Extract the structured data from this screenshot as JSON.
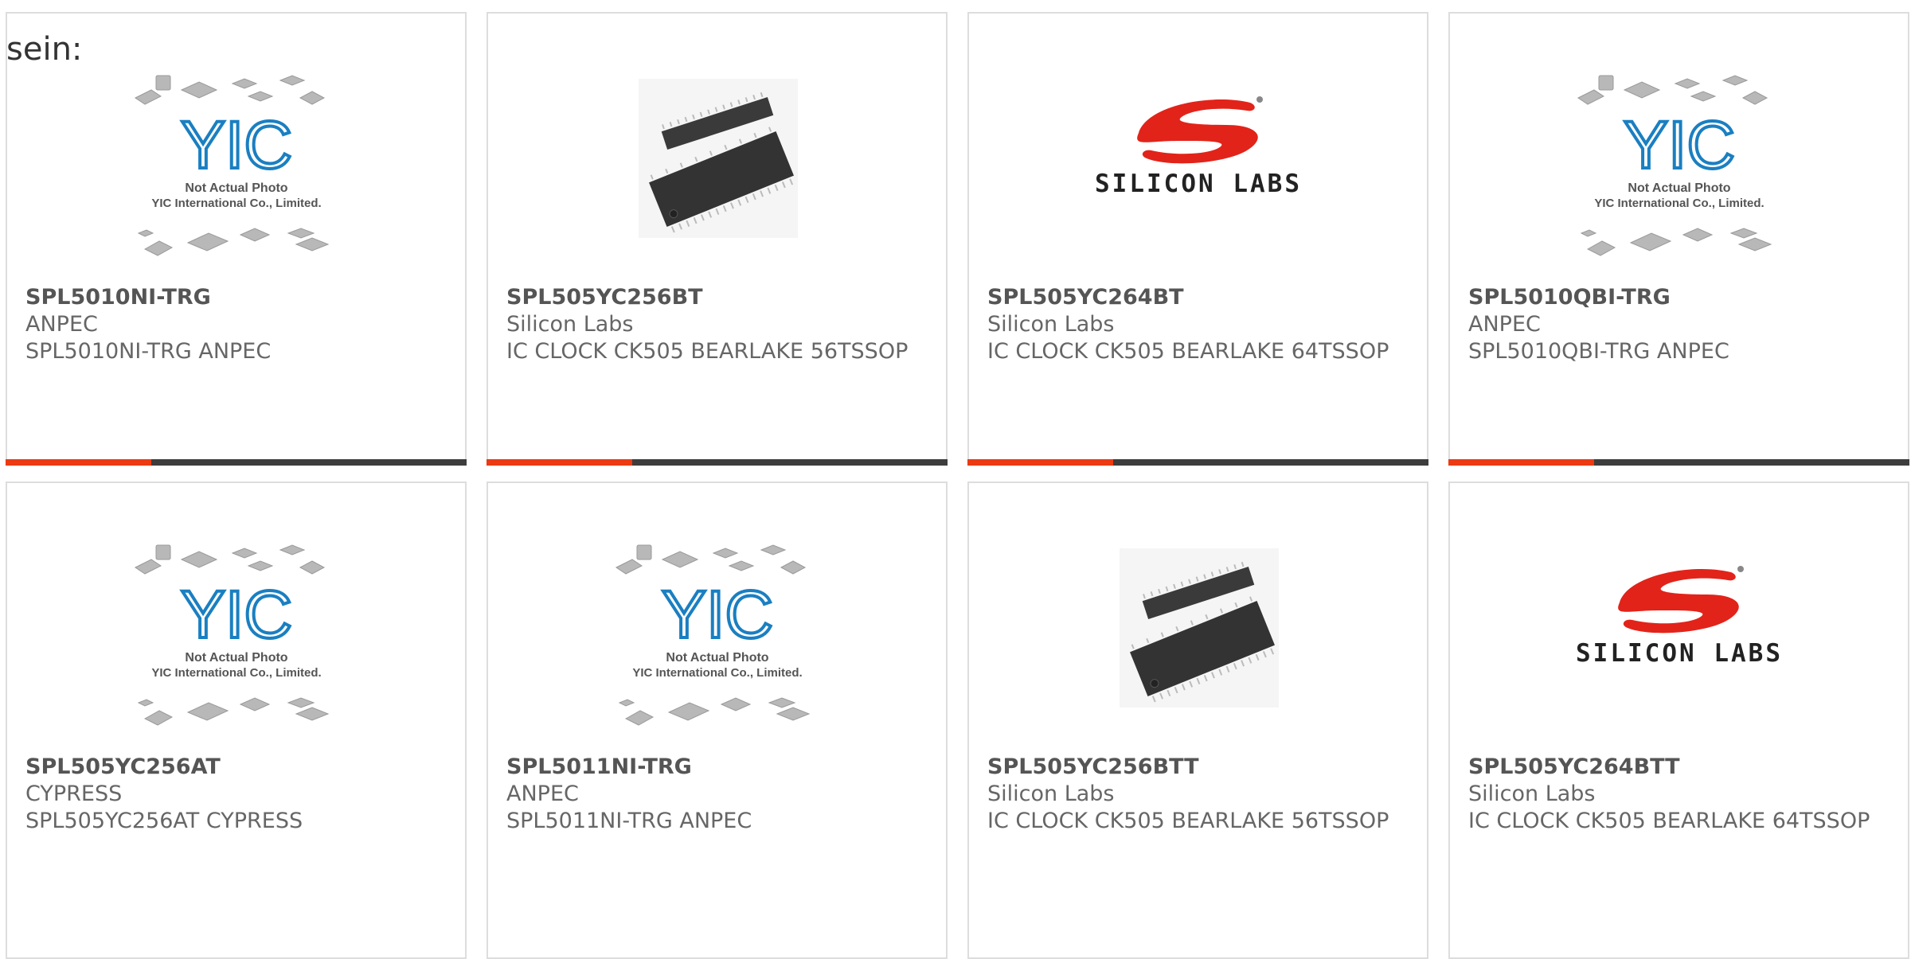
{
  "intro_text": "sein:",
  "colors": {
    "accent": "#ec3a12",
    "bar": "#3d3d3d",
    "logo_red": "#e2231a",
    "yic_blue": "#1a7fc1"
  },
  "yic_placeholder": {
    "logo_text": "YIC",
    "line1": "Not Actual Photo",
    "line2": "YIC International Co., Limited."
  },
  "silicon_labs_logo_text": "SILICON LABS",
  "products": [
    {
      "part": "SPL5010NI-TRG",
      "manufacturer": "ANPEC",
      "description": "SPL5010NI-TRG ANPEC",
      "image": "yic-placeholder"
    },
    {
      "part": "SPL505YC256BT",
      "manufacturer": "Silicon Labs",
      "description": "IC CLOCK CK505 BEARLAKE 56TSSOP",
      "image": "tssop-photo"
    },
    {
      "part": "SPL505YC264BT",
      "manufacturer": "Silicon Labs",
      "description": "IC CLOCK CK505 BEARLAKE 64TSSOP",
      "image": "silicon-labs-logo"
    },
    {
      "part": "SPL5010QBI-TRG",
      "manufacturer": "ANPEC",
      "description": "SPL5010QBI-TRG ANPEC",
      "image": "yic-placeholder"
    },
    {
      "part": "SPL505YC256AT",
      "manufacturer": "CYPRESS",
      "description": "SPL505YC256AT CYPRESS",
      "image": "yic-placeholder"
    },
    {
      "part": "SPL5011NI-TRG",
      "manufacturer": "ANPEC",
      "description": "SPL5011NI-TRG ANPEC",
      "image": "yic-placeholder"
    },
    {
      "part": "SPL505YC256BTT",
      "manufacturer": "Silicon Labs",
      "description": "IC CLOCK CK505 BEARLAKE 56TSSOP",
      "image": "tssop-photo"
    },
    {
      "part": "SPL505YC264BTT",
      "manufacturer": "Silicon Labs",
      "description": "IC CLOCK CK505 BEARLAKE 64TSSOP",
      "image": "silicon-labs-logo"
    }
  ]
}
